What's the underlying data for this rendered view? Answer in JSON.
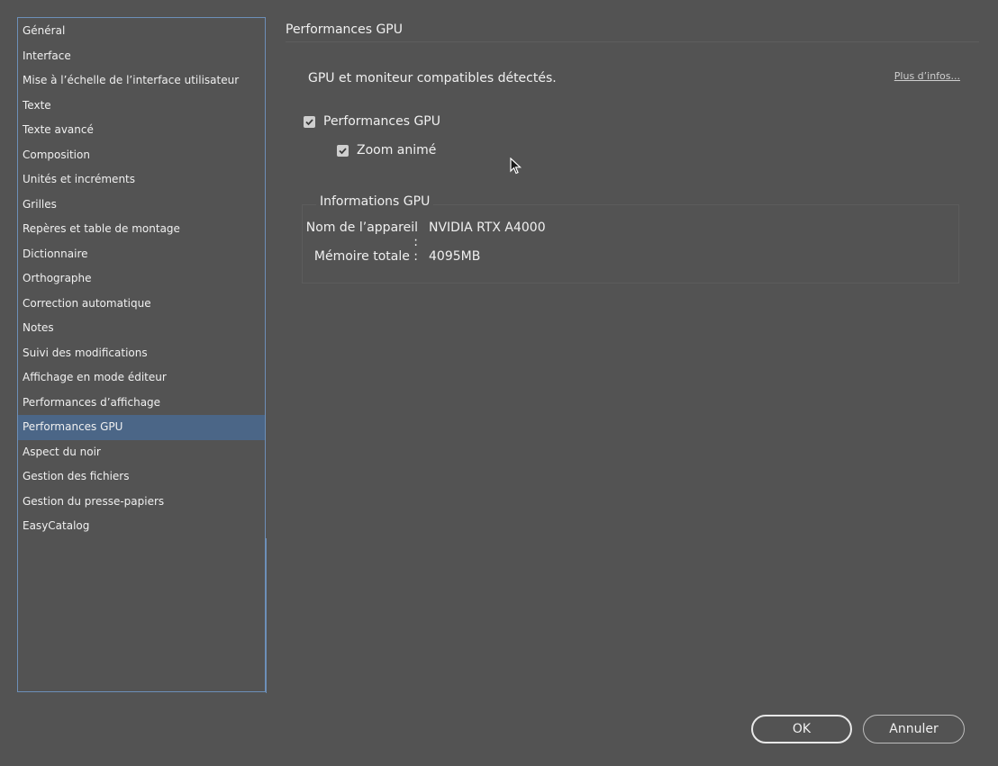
{
  "sidebar": {
    "items": [
      {
        "label": "Général"
      },
      {
        "label": "Interface"
      },
      {
        "label": "Mise à l’échelle de l’interface utilisateur"
      },
      {
        "label": "Texte"
      },
      {
        "label": "Texte avancé"
      },
      {
        "label": "Composition"
      },
      {
        "label": "Unités et incréments"
      },
      {
        "label": "Grilles"
      },
      {
        "label": "Repères et table de montage"
      },
      {
        "label": "Dictionnaire"
      },
      {
        "label": "Orthographe"
      },
      {
        "label": "Correction automatique"
      },
      {
        "label": "Notes"
      },
      {
        "label": "Suivi des modifications"
      },
      {
        "label": "Affichage en mode éditeur"
      },
      {
        "label": "Performances d’affichage"
      },
      {
        "label": "Performances GPU"
      },
      {
        "label": "Aspect du noir"
      },
      {
        "label": "Gestion des fichiers"
      },
      {
        "label": "Gestion du presse-papiers"
      },
      {
        "label": "EasyCatalog"
      }
    ],
    "selected_label": "Performances GPU"
  },
  "main": {
    "section_title": "Performances GPU",
    "status_text": "GPU et moniteur compatibles détectés.",
    "more_info_link": "Plus d’infos...",
    "checkboxes": {
      "gpu_performance": {
        "label": "Performances GPU",
        "checked": true
      },
      "animated_zoom": {
        "label": "Zoom animé",
        "checked": true
      }
    },
    "gpu_info": {
      "title": "Informations GPU",
      "device_label": "Nom de l’appareil :",
      "device_value": "NVIDIA RTX A4000",
      "memory_label": "Mémoire totale :",
      "memory_value": "4095MB"
    }
  },
  "buttons": {
    "ok_label": "OK",
    "cancel_label": "Annuler"
  },
  "colors": {
    "background": "#535353",
    "selection": "#4b6687",
    "focus_border": "#6d8fb8"
  },
  "icons": {
    "checkbox": "checkmark-icon",
    "cursor": "mouse-pointer-icon"
  }
}
